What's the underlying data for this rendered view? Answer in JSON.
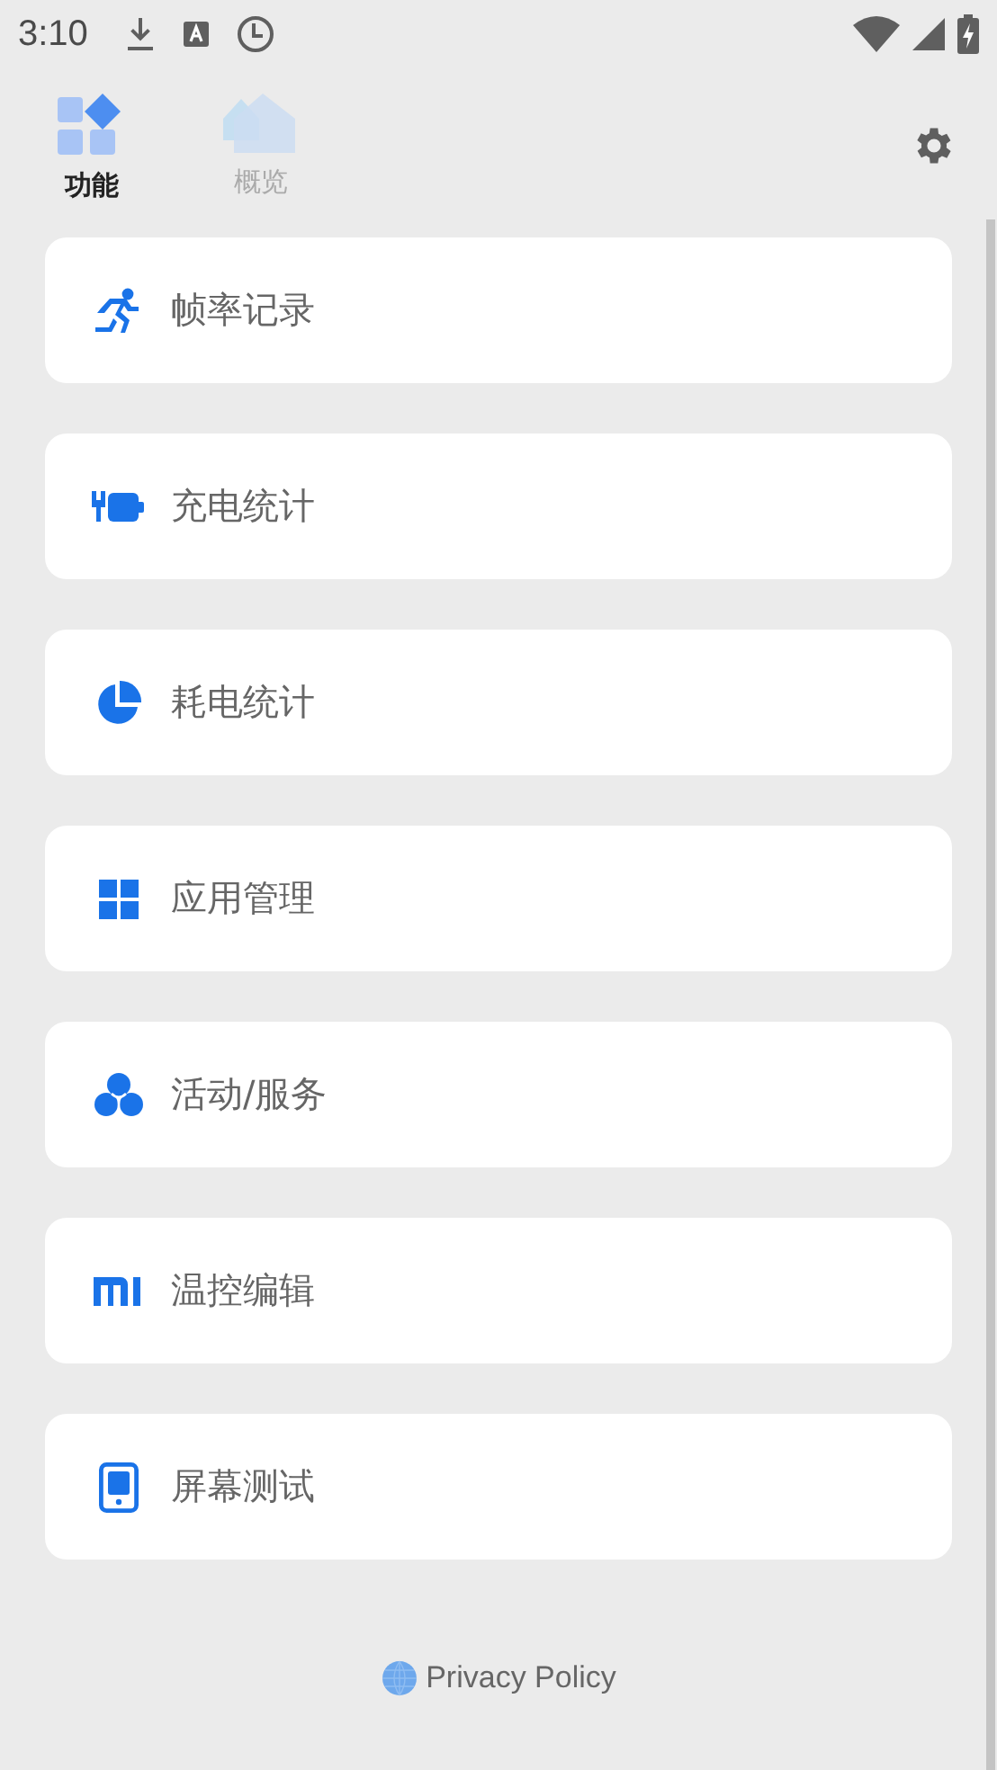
{
  "status_bar": {
    "time": "3:10"
  },
  "tabs": [
    {
      "label": "功能",
      "selected": true
    },
    {
      "label": "概览",
      "selected": false
    }
  ],
  "menu_items": [
    {
      "label": "帧率记录"
    },
    {
      "label": "充电统计"
    },
    {
      "label": "耗电统计"
    },
    {
      "label": "应用管理"
    },
    {
      "label": "活动/服务"
    },
    {
      "label": "温控编辑"
    },
    {
      "label": "屏幕测试"
    }
  ],
  "footer": {
    "link": "Privacy Policy"
  }
}
